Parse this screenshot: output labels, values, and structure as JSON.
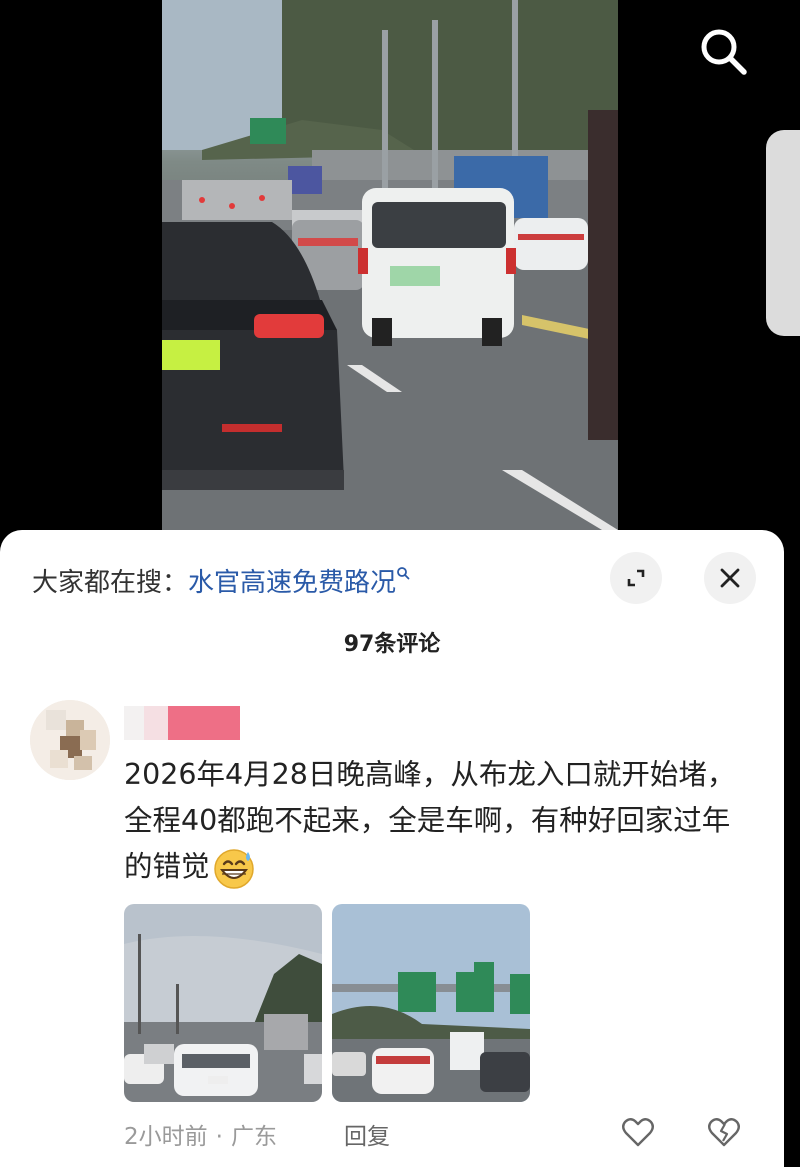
{
  "video": {
    "icons": {
      "search": "search-icon"
    }
  },
  "sheet": {
    "search_hint": {
      "prefix": "大家都在搜：",
      "keyword": "水官高速免费路况"
    },
    "comment_count_label": "97条评论",
    "comments": [
      {
        "text": "2026年4月28日晚高峰，从布龙入口就开始堵，全程40都跑不起来，全是车啊，有种好回家过年的错觉",
        "emoji": "grinning-sweat-emoji",
        "time": "2小时前",
        "location": "广东",
        "reply_label": "回复",
        "separator": "·"
      }
    ]
  },
  "colors": {
    "keyword": "#2a5aa8",
    "meta_text": "#9a9a9a",
    "sheet_bg": "#ffffff"
  }
}
